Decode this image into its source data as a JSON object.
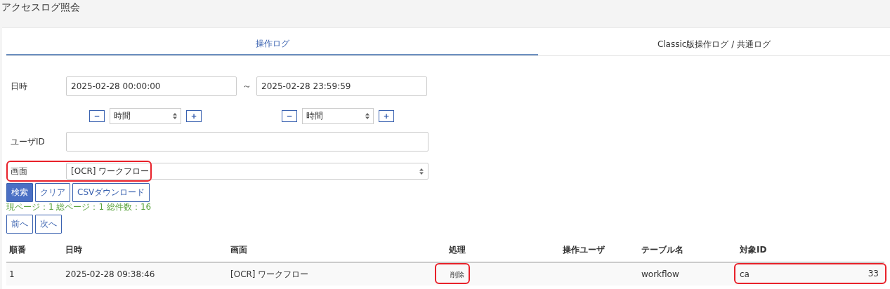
{
  "page_title": "アクセスログ照会",
  "tabs": [
    {
      "label": "操作ログ",
      "selected": true
    },
    {
      "label": "Classic版操作ログ / 共通ログ",
      "selected": false
    }
  ],
  "filters": {
    "datetime": {
      "label": "日時",
      "from": "2025-02-28 00:00:00",
      "separator": "～",
      "to": "2025-02-28 23:59:59",
      "steppers": [
        {
          "minus": "−",
          "unit": "時間",
          "plus": "+"
        },
        {
          "minus": "−",
          "unit": "時間",
          "plus": "+"
        }
      ]
    },
    "user_id": {
      "label": "ユーザID"
    },
    "screen": {
      "label": "画面",
      "value": "[OCR] ワークフロー",
      "highlighted": true
    }
  },
  "buttons": [
    {
      "label": "検索",
      "primary": true
    },
    {
      "label": "クリア",
      "primary": false
    },
    {
      "label": "CSVダウンロード",
      "primary": false
    }
  ],
  "page_info": "現ページ：1 総ページ：1 総件数：16",
  "pager": [
    "前へ",
    "次へ"
  ],
  "table": {
    "columns": [
      "順番",
      "日時",
      "画面",
      "処理",
      "操作ユーザ",
      "テーブル名",
      "対象ID"
    ],
    "rows": [
      {
        "cells": [
          {
            "text": "1",
            "highlighted": false
          },
          {
            "text": "2025-02-28 09:38:46",
            "highlighted": false
          },
          {
            "text": "[OCR] ワークフロー",
            "highlighted": false
          },
          {
            "text": "削除",
            "highlighted": true
          },
          {
            "text": "",
            "highlighted": false
          },
          {
            "text": "workflow",
            "highlighted": false
          },
          {
            "text": "ca",
            "extra": "33",
            "highlighted": true
          }
        ]
      }
    ]
  }
}
